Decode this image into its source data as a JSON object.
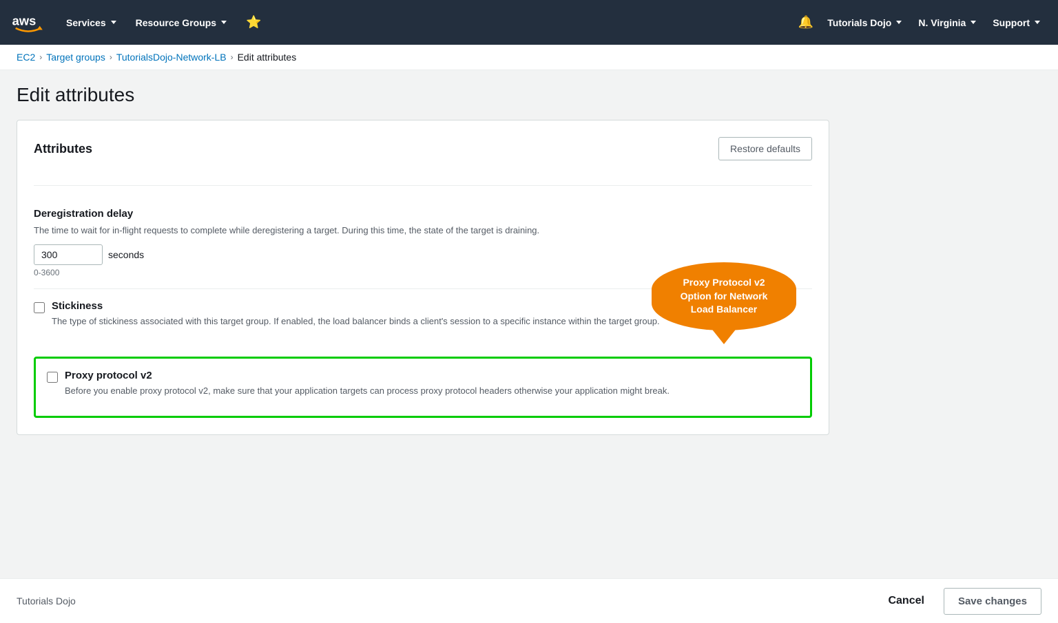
{
  "nav": {
    "services_label": "Services",
    "resource_groups_label": "Resource Groups",
    "tutorials_dojo_label": "Tutorials Dojo",
    "region_label": "N. Virginia",
    "support_label": "Support"
  },
  "breadcrumb": {
    "ec2": "EC2",
    "target_groups": "Target groups",
    "lb_name": "TutorialsDojo-Network-LB",
    "current": "Edit attributes"
  },
  "page": {
    "title": "Edit attributes"
  },
  "card": {
    "title": "Attributes",
    "restore_defaults_label": "Restore defaults"
  },
  "attributes": {
    "deregistration_delay": {
      "label": "Deregistration delay",
      "description": "The time to wait for in-flight requests to complete while deregistering a target. During this time, the state of the target is draining.",
      "value": "300",
      "unit": "seconds",
      "range": "0-3600"
    },
    "stickiness": {
      "label": "Stickiness",
      "description": "The type of stickiness associated with this target group. If enabled, the load balancer binds a client's session to a specific instance within the target group.",
      "checked": false
    },
    "proxy_protocol": {
      "label": "Proxy protocol v2",
      "description": "Before you enable proxy protocol v2, make sure that your application targets can process proxy protocol headers otherwise your application might break.",
      "checked": false
    }
  },
  "tooltip": {
    "text": "Proxy Protocol v2 Option for Network Load Balancer"
  },
  "footer": {
    "brand": "Tutorials Dojo",
    "cancel_label": "Cancel",
    "save_label": "Save changes"
  }
}
